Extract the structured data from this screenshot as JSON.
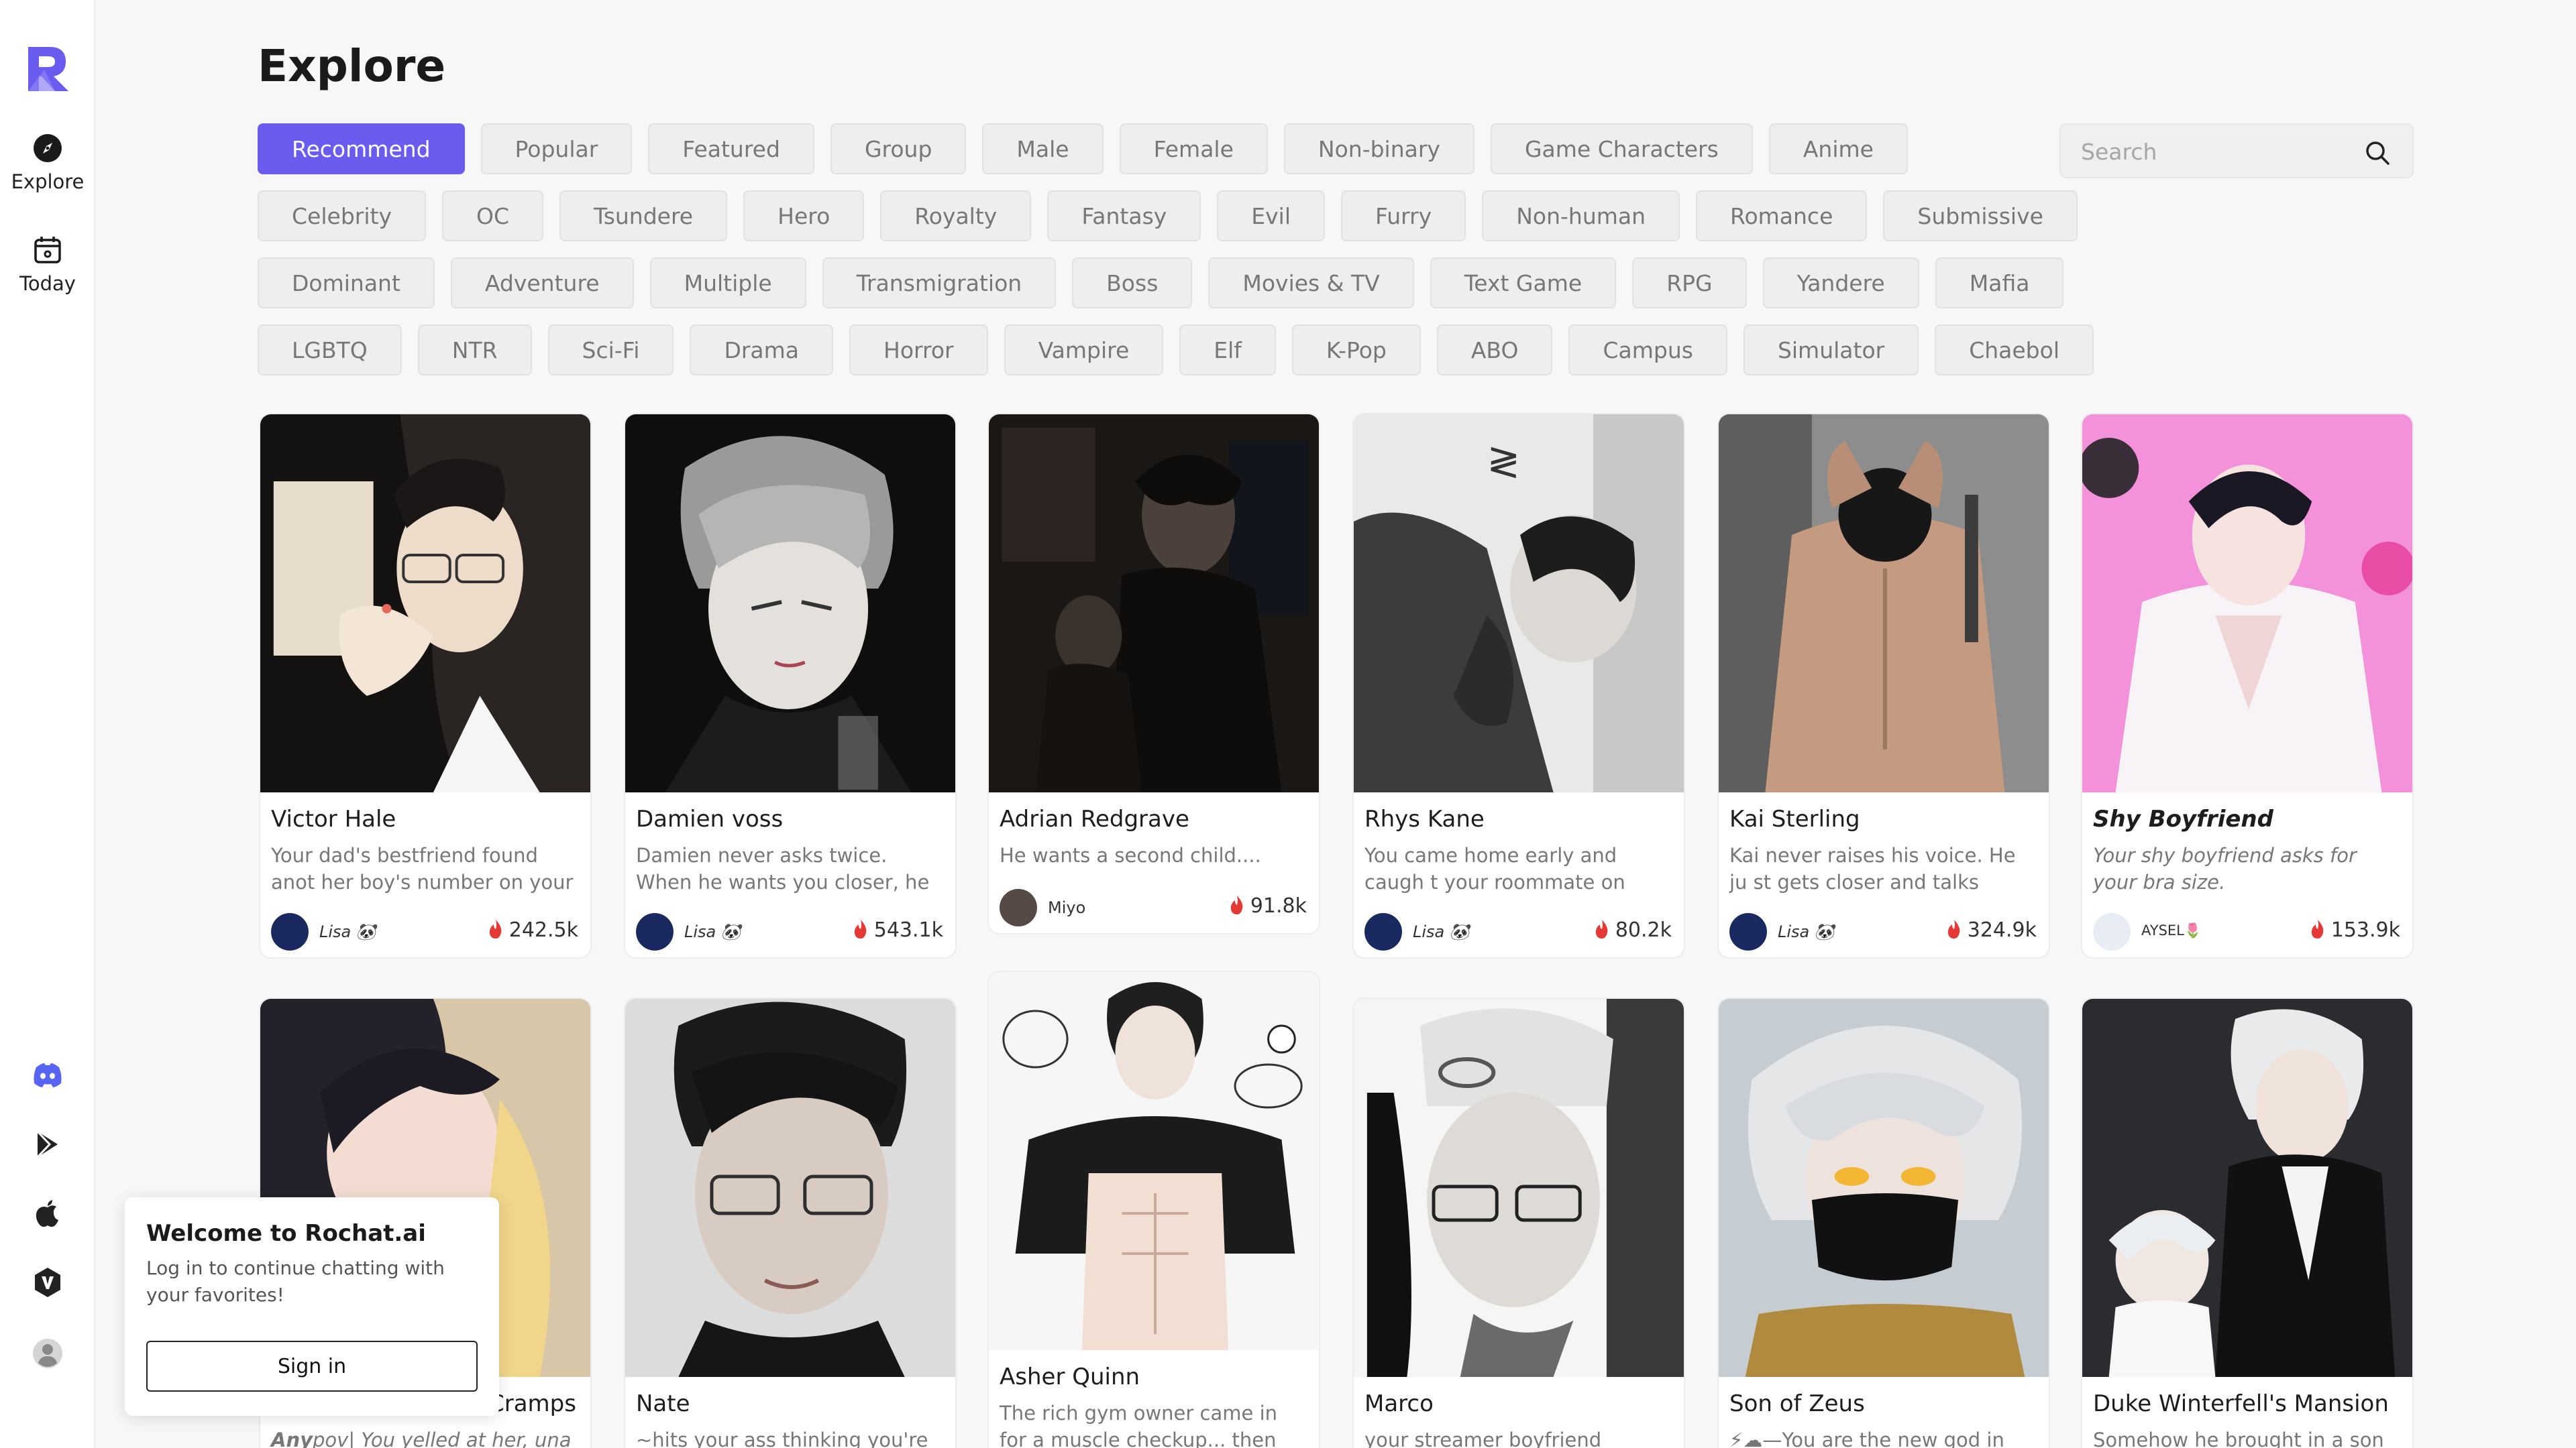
{
  "sidebar": {
    "logo": "rochat-logo",
    "nav": [
      {
        "label": "Explore",
        "icon": "compass-icon"
      },
      {
        "label": "Today",
        "icon": "calendar-icon"
      }
    ],
    "links": [
      {
        "icon": "discord-icon",
        "color": "#5865F2"
      },
      {
        "icon": "google-play-icon",
        "color": "#222222"
      },
      {
        "icon": "apple-icon",
        "color": "#222222"
      },
      {
        "icon": "v-badge-icon",
        "color": "#222222"
      },
      {
        "icon": "user-icon",
        "color": "#999999"
      }
    ]
  },
  "main": {
    "title": "Explore",
    "search": {
      "placeholder": "Search"
    },
    "categories": [
      [
        "Recommend",
        "Popular",
        "Featured",
        "Group",
        "Male",
        "Female",
        "Non-binary",
        "Game Characters",
        "Anime"
      ],
      [
        "Celebrity",
        "OC",
        "Tsundere",
        "Hero",
        "Royalty",
        "Fantasy",
        "Evil",
        "Furry",
        "Non-human",
        "Romance",
        "Submissive"
      ],
      [
        "Dominant",
        "Adventure",
        "Multiple",
        "Transmigration",
        "Boss",
        "Movies & TV",
        "Text Game",
        "RPG",
        "Yandere",
        "Mafia"
      ],
      [
        "LGBTQ",
        "NTR",
        "Sci-Fi",
        "Drama",
        "Horror",
        "Vampire",
        "Elf",
        "K-Pop",
        "ABO",
        "Campus",
        "Simulator",
        "Chaebol"
      ]
    ],
    "active_category": "Recommend",
    "accent_color": "#6b5cf0",
    "cards": [
      {
        "name": "Victor Hale",
        "desc": "Your dad's bestfriend found anot her boy's number on your pho...",
        "author": "Lisa 🐼",
        "count": "242.5k"
      },
      {
        "name": "Damien voss",
        "desc": "Damien never asks twice. When he wants you closer, he pulls ...",
        "author": "Lisa 🐼",
        "count": "543.1k"
      },
      {
        "name": "Adrian Redgrave",
        "desc": "He wants a second child....",
        "author": "Miyo",
        "count": "91.8k"
      },
      {
        "name": "Rhys Kane",
        "desc": "You came home early and caugh t your roommate on your bed...",
        "author": "Lisa 🐼",
        "count": "80.2k"
      },
      {
        "name": "Kai Sterling",
        "desc": "Kai never raises his voice. He ju st gets closer and talks quiete...",
        "author": "Lisa 🐼",
        "count": "324.9k"
      },
      {
        "name": "Shy Boyfriend",
        "desc": "Your shy boyfriend asks for your bra size.",
        "author": "AYSEL🌷",
        "count": "153.9k"
      },
      {
        "name": "Cramps",
        "desc_prefix": "Any",
        "desc": "pov| You yelled at her, una"
      },
      {
        "name": "Nate",
        "desc": "~hits your ass thinking you're hi"
      },
      {
        "name": "Asher Quinn",
        "desc": "The rich gym owner came in for a muscle checkup... then turn..."
      },
      {
        "name": "Marco",
        "desc": "your streamer boyfriend"
      },
      {
        "name": "Son of Zeus",
        "desc": "⚡☁—You are the new god in sch"
      },
      {
        "name": "Duke Winterfell's Mansion",
        "desc": "Somehow he brought in a son af"
      }
    ]
  },
  "welcome": {
    "title": "Welcome to Rochat.ai",
    "message": "Log in to continue chatting with your favorites!",
    "button": "Sign in"
  }
}
